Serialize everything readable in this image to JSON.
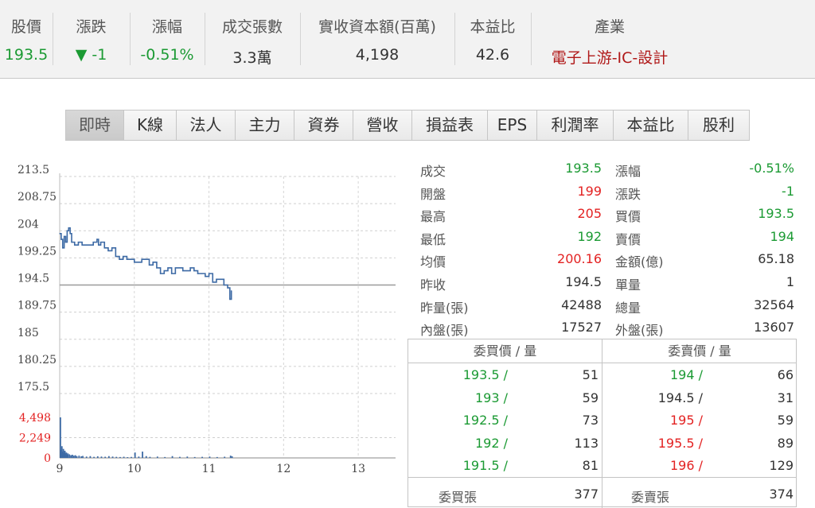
{
  "summary": {
    "cols": [
      {
        "label": "股價",
        "value": "193.5"
      },
      {
        "label": "漲跌",
        "value": "▼ -1"
      },
      {
        "label": "漲幅",
        "value": "-0.51%"
      },
      {
        "label": "成交張數",
        "value": "3.3萬"
      },
      {
        "label": "實收資本額(百萬)",
        "value": "4,198"
      },
      {
        "label": "本益比",
        "value": "42.6"
      },
      {
        "label": "產業",
        "value": "電子上游-IC-設計"
      }
    ]
  },
  "tabs": [
    "即時",
    "K線",
    "法人",
    "主力",
    "資券",
    "營收",
    "損益表",
    "EPS",
    "利潤率",
    "本益比",
    "股利"
  ],
  "active_tab": "即時",
  "quotes": {
    "rows": [
      {
        "l1": "成交",
        "v1": "193.5",
        "l2": "漲幅",
        "v2": "-0.51%"
      },
      {
        "l1": "開盤",
        "v1": "199",
        "l2": "漲跌",
        "v2": "-1"
      },
      {
        "l1": "最高",
        "v1": "205",
        "l2": "買價",
        "v2": "193.5"
      },
      {
        "l1": "最低",
        "v1": "192",
        "l2": "賣價",
        "v2": "194"
      },
      {
        "l1": "均價",
        "v1": "200.16",
        "l2": "金額(億)",
        "v2": "65.18"
      },
      {
        "l1": "昨收",
        "v1": "194.5",
        "l2": "單量",
        "v2": "1"
      },
      {
        "l1": "昨量(張)",
        "v1": "42488",
        "l2": "總量",
        "v2": "32564"
      },
      {
        "l1": "內盤(張)",
        "v1": "17527",
        "l2": "外盤(張)",
        "v2": "13607"
      }
    ]
  },
  "book": {
    "bid_header": "委買價 / 量",
    "ask_header": "委賣價 / 量",
    "bids": [
      {
        "price": "193.5 /",
        "qty": "51"
      },
      {
        "price": "193 /",
        "qty": "59"
      },
      {
        "price": "192.5 /",
        "qty": "73"
      },
      {
        "price": "192 /",
        "qty": "113"
      },
      {
        "price": "191.5 /",
        "qty": "81"
      }
    ],
    "asks": [
      {
        "price": "194 /",
        "qty": "66"
      },
      {
        "price": "194.5 /",
        "qty": "31"
      },
      {
        "price": "195 /",
        "qty": "59"
      },
      {
        "price": "195.5 /",
        "qty": "89"
      },
      {
        "price": "196 /",
        "qty": "129"
      }
    ],
    "bid_total_label": "委買張",
    "bid_total": "377",
    "ask_total_label": "委賣張",
    "ask_total": "374"
  },
  "colors": {
    "up": "#e32222",
    "down": "#1b9a33",
    "neutral": "#333333",
    "line": "#3d6aa5",
    "industry": "#b01818"
  },
  "chart_data": {
    "type": "line",
    "x_ticks": [
      "9",
      "10",
      "11",
      "12",
      "13"
    ],
    "y_ticks": [
      "213.5",
      "208.75",
      "204",
      "199.25",
      "194.5",
      "189.75",
      "185",
      "180.25",
      "175.5"
    ],
    "ylim": [
      175.5,
      213.5
    ],
    "reference": 194.5,
    "xlim": [
      9.0,
      13.5
    ],
    "price_series": {
      "x": [
        9.0,
        9.02,
        9.04,
        9.06,
        9.08,
        9.1,
        9.12,
        9.14,
        9.16,
        9.2,
        9.25,
        9.3,
        9.35,
        9.4,
        9.45,
        9.5,
        9.52,
        9.55,
        9.6,
        9.65,
        9.7,
        9.75,
        9.8,
        9.85,
        9.9,
        9.95,
        10.0,
        10.05,
        10.1,
        10.15,
        10.2,
        10.25,
        10.3,
        10.35,
        10.4,
        10.45,
        10.5,
        10.55,
        10.6,
        10.65,
        10.7,
        10.75,
        10.8,
        10.85,
        10.9,
        10.95,
        11.0,
        11.05,
        11.1,
        11.15,
        11.2,
        11.25,
        11.28,
        11.3
      ],
      "y": [
        203.5,
        202.5,
        201.0,
        203.0,
        202.0,
        204.0,
        204.5,
        203.5,
        202.0,
        201.5,
        202.0,
        201.5,
        201.5,
        201.5,
        202.0,
        202.5,
        201.5,
        202.0,
        201.0,
        200.5,
        201.0,
        199.5,
        199.0,
        199.5,
        199.0,
        199.0,
        198.5,
        198.5,
        199.0,
        199.0,
        198.0,
        198.5,
        197.5,
        196.5,
        197.0,
        197.5,
        196.5,
        197.5,
        197.5,
        197.0,
        197.0,
        197.5,
        197.0,
        196.5,
        196.5,
        196.0,
        196.5,
        195.0,
        195.5,
        195.5,
        194.5,
        194.0,
        192.0,
        193.5
      ]
    },
    "volume_ticks": [
      "4,498",
      "2,249",
      "0"
    ],
    "volume_ylim": [
      0,
      4498
    ],
    "volume_series": {
      "x": [
        9.0,
        9.01,
        9.02,
        9.03,
        9.04,
        9.05,
        9.06,
        9.07,
        9.08,
        9.09,
        9.1,
        9.12,
        9.14,
        9.16,
        9.18,
        9.2,
        9.22,
        9.25,
        9.28,
        9.3,
        9.35,
        9.4,
        9.45,
        9.5,
        9.55,
        9.6,
        9.65,
        9.7,
        9.75,
        9.8,
        9.85,
        9.9,
        9.95,
        10.0,
        10.05,
        10.1,
        10.15,
        10.2,
        10.3,
        10.4,
        10.5,
        10.6,
        10.7,
        10.8,
        10.9,
        11.0,
        11.1,
        11.2,
        11.28,
        11.3
      ],
      "y": [
        4498,
        900,
        1300,
        700,
        1000,
        600,
        800,
        450,
        600,
        350,
        500,
        400,
        300,
        350,
        250,
        300,
        200,
        250,
        180,
        220,
        150,
        200,
        120,
        180,
        150,
        130,
        200,
        150,
        120,
        100,
        130,
        90,
        110,
        600,
        150,
        700,
        200,
        120,
        150,
        100,
        200,
        120,
        150,
        100,
        120,
        150,
        100,
        130,
        250,
        180
      ]
    }
  }
}
